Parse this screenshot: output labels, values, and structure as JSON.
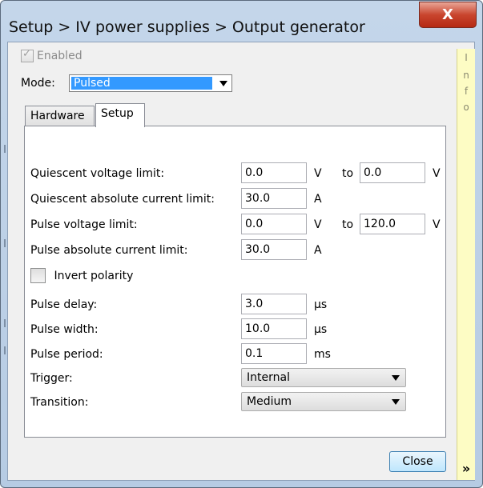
{
  "window": {
    "title": "Setup > IV power supplies > Output generator",
    "close_glyph": "X"
  },
  "info_panel": {
    "letters": [
      "I",
      "n",
      "f",
      "o"
    ],
    "expand_glyph": "»"
  },
  "enabled": {
    "label": "Enabled",
    "checked": true,
    "disabled": true
  },
  "mode": {
    "label": "Mode:",
    "value": "Pulsed"
  },
  "tabs": [
    {
      "label": "Hardware",
      "active": false
    },
    {
      "label": "Setup",
      "active": true
    }
  ],
  "fields": {
    "quiescent_voltage": {
      "label": "Quiescent voltage limit:",
      "from": "0.0",
      "unit": "V",
      "to_label": "to",
      "to": "0.0",
      "to_unit": "V"
    },
    "quiescent_current": {
      "label": "Quiescent absolute current limit:",
      "value": "30.0",
      "unit": "A"
    },
    "pulse_voltage": {
      "label": "Pulse voltage limit:",
      "from": "0.0",
      "unit": "V",
      "to_label": "to",
      "to": "120.0",
      "to_unit": "V"
    },
    "pulse_current": {
      "label": "Pulse absolute current limit:",
      "value": "30.0",
      "unit": "A"
    },
    "invert_polarity": {
      "label": "Invert polarity",
      "checked": false
    },
    "pulse_delay": {
      "label": "Pulse delay:",
      "value": "3.0",
      "unit": "µs"
    },
    "pulse_width": {
      "label": "Pulse width:",
      "value": "10.0",
      "unit": "µs"
    },
    "pulse_period": {
      "label": "Pulse period:",
      "value": "0.1",
      "unit": "ms"
    },
    "trigger": {
      "label": "Trigger:",
      "value": "Internal"
    },
    "transition": {
      "label": "Transition:",
      "value": "Medium"
    }
  },
  "buttons": {
    "close": "Close"
  }
}
